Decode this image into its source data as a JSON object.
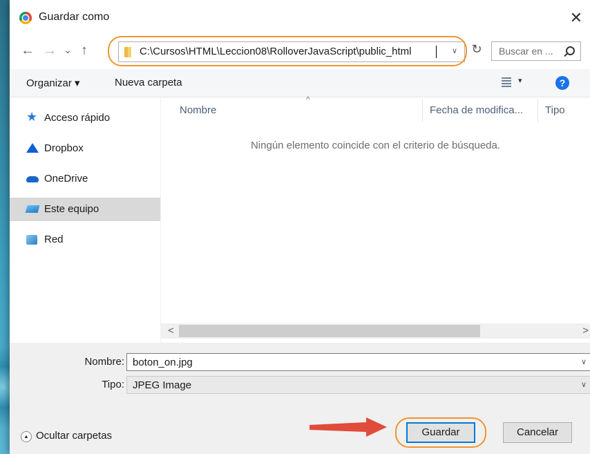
{
  "window": {
    "title": "Guardar como",
    "close_glyph": "✕"
  },
  "nav": {
    "back_glyph": "←",
    "forward_glyph": "→",
    "history_glyph": "⌄",
    "up_glyph": "↑",
    "address": "C:\\Cursos\\HTML\\Leccion08\\RolloverJavaScript\\public_html",
    "address_dd_glyph": "∨",
    "refresh_glyph": "↻",
    "search_placeholder": "Buscar en ..."
  },
  "toolbar": {
    "organize_label": "Organizar ▾",
    "new_folder_label": "Nueva carpeta",
    "view_dd_glyph": "▾",
    "help_glyph": "?"
  },
  "sidebar": {
    "items": [
      {
        "label": "Acceso rápido",
        "icon": "quick-access-star-icon"
      },
      {
        "label": "Dropbox",
        "icon": "dropbox-icon"
      },
      {
        "label": "OneDrive",
        "icon": "onedrive-cloud-icon"
      },
      {
        "label": "Este equipo",
        "icon": "this-pc-icon",
        "selected": true
      },
      {
        "label": "Red",
        "icon": "network-icon"
      }
    ]
  },
  "list": {
    "columns": [
      "Nombre",
      "Fecha de modifica...",
      "Tipo"
    ],
    "sort_glyph": "^",
    "empty_message": "Ningún elemento coincide con el criterio de búsqueda.",
    "scroll_left_glyph": "<",
    "scroll_right_glyph": ">"
  },
  "form": {
    "name_label": "Nombre:",
    "name_value": "boton_on.jpg",
    "type_label": "Tipo:",
    "type_value": "JPEG Image",
    "dd_glyph": "∨"
  },
  "footer": {
    "hide_folders_label": "Ocultar carpetas",
    "hide_glyph": "▲",
    "save_label": "Guardar",
    "cancel_label": "Cancelar"
  },
  "colors": {
    "highlight": "#f0952e",
    "accent": "#0078d7",
    "arrow": "#e04b3a"
  }
}
